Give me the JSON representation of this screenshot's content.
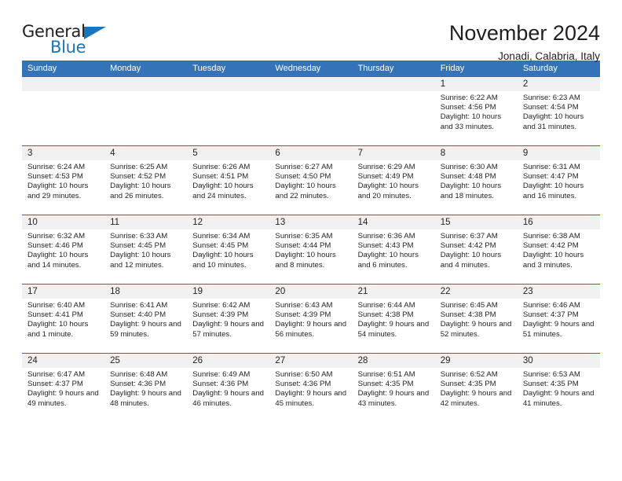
{
  "brand": {
    "name_part1": "General",
    "name_part2": "Blue",
    "accent_color": "#1b75bb"
  },
  "header": {
    "title": "November 2024",
    "subtitle": "Jonadi, Calabria, Italy"
  },
  "calendar": {
    "header_bg": "#3573b9",
    "weekdays": [
      "Sunday",
      "Monday",
      "Tuesday",
      "Wednesday",
      "Thursday",
      "Friday",
      "Saturday"
    ],
    "weeks": [
      [
        {
          "day": "",
          "sunrise": "",
          "sunset": "",
          "daylight": ""
        },
        {
          "day": "",
          "sunrise": "",
          "sunset": "",
          "daylight": ""
        },
        {
          "day": "",
          "sunrise": "",
          "sunset": "",
          "daylight": ""
        },
        {
          "day": "",
          "sunrise": "",
          "sunset": "",
          "daylight": ""
        },
        {
          "day": "",
          "sunrise": "",
          "sunset": "",
          "daylight": ""
        },
        {
          "day": "1",
          "sunrise": "Sunrise: 6:22 AM",
          "sunset": "Sunset: 4:56 PM",
          "daylight": "Daylight: 10 hours and 33 minutes."
        },
        {
          "day": "2",
          "sunrise": "Sunrise: 6:23 AM",
          "sunset": "Sunset: 4:54 PM",
          "daylight": "Daylight: 10 hours and 31 minutes."
        }
      ],
      [
        {
          "day": "3",
          "sunrise": "Sunrise: 6:24 AM",
          "sunset": "Sunset: 4:53 PM",
          "daylight": "Daylight: 10 hours and 29 minutes."
        },
        {
          "day": "4",
          "sunrise": "Sunrise: 6:25 AM",
          "sunset": "Sunset: 4:52 PM",
          "daylight": "Daylight: 10 hours and 26 minutes."
        },
        {
          "day": "5",
          "sunrise": "Sunrise: 6:26 AM",
          "sunset": "Sunset: 4:51 PM",
          "daylight": "Daylight: 10 hours and 24 minutes."
        },
        {
          "day": "6",
          "sunrise": "Sunrise: 6:27 AM",
          "sunset": "Sunset: 4:50 PM",
          "daylight": "Daylight: 10 hours and 22 minutes."
        },
        {
          "day": "7",
          "sunrise": "Sunrise: 6:29 AM",
          "sunset": "Sunset: 4:49 PM",
          "daylight": "Daylight: 10 hours and 20 minutes."
        },
        {
          "day": "8",
          "sunrise": "Sunrise: 6:30 AM",
          "sunset": "Sunset: 4:48 PM",
          "daylight": "Daylight: 10 hours and 18 minutes."
        },
        {
          "day": "9",
          "sunrise": "Sunrise: 6:31 AM",
          "sunset": "Sunset: 4:47 PM",
          "daylight": "Daylight: 10 hours and 16 minutes."
        }
      ],
      [
        {
          "day": "10",
          "sunrise": "Sunrise: 6:32 AM",
          "sunset": "Sunset: 4:46 PM",
          "daylight": "Daylight: 10 hours and 14 minutes."
        },
        {
          "day": "11",
          "sunrise": "Sunrise: 6:33 AM",
          "sunset": "Sunset: 4:45 PM",
          "daylight": "Daylight: 10 hours and 12 minutes."
        },
        {
          "day": "12",
          "sunrise": "Sunrise: 6:34 AM",
          "sunset": "Sunset: 4:45 PM",
          "daylight": "Daylight: 10 hours and 10 minutes."
        },
        {
          "day": "13",
          "sunrise": "Sunrise: 6:35 AM",
          "sunset": "Sunset: 4:44 PM",
          "daylight": "Daylight: 10 hours and 8 minutes."
        },
        {
          "day": "14",
          "sunrise": "Sunrise: 6:36 AM",
          "sunset": "Sunset: 4:43 PM",
          "daylight": "Daylight: 10 hours and 6 minutes."
        },
        {
          "day": "15",
          "sunrise": "Sunrise: 6:37 AM",
          "sunset": "Sunset: 4:42 PM",
          "daylight": "Daylight: 10 hours and 4 minutes."
        },
        {
          "day": "16",
          "sunrise": "Sunrise: 6:38 AM",
          "sunset": "Sunset: 4:42 PM",
          "daylight": "Daylight: 10 hours and 3 minutes."
        }
      ],
      [
        {
          "day": "17",
          "sunrise": "Sunrise: 6:40 AM",
          "sunset": "Sunset: 4:41 PM",
          "daylight": "Daylight: 10 hours and 1 minute."
        },
        {
          "day": "18",
          "sunrise": "Sunrise: 6:41 AM",
          "sunset": "Sunset: 4:40 PM",
          "daylight": "Daylight: 9 hours and 59 minutes."
        },
        {
          "day": "19",
          "sunrise": "Sunrise: 6:42 AM",
          "sunset": "Sunset: 4:39 PM",
          "daylight": "Daylight: 9 hours and 57 minutes."
        },
        {
          "day": "20",
          "sunrise": "Sunrise: 6:43 AM",
          "sunset": "Sunset: 4:39 PM",
          "daylight": "Daylight: 9 hours and 56 minutes."
        },
        {
          "day": "21",
          "sunrise": "Sunrise: 6:44 AM",
          "sunset": "Sunset: 4:38 PM",
          "daylight": "Daylight: 9 hours and 54 minutes."
        },
        {
          "day": "22",
          "sunrise": "Sunrise: 6:45 AM",
          "sunset": "Sunset: 4:38 PM",
          "daylight": "Daylight: 9 hours and 52 minutes."
        },
        {
          "day": "23",
          "sunrise": "Sunrise: 6:46 AM",
          "sunset": "Sunset: 4:37 PM",
          "daylight": "Daylight: 9 hours and 51 minutes."
        }
      ],
      [
        {
          "day": "24",
          "sunrise": "Sunrise: 6:47 AM",
          "sunset": "Sunset: 4:37 PM",
          "daylight": "Daylight: 9 hours and 49 minutes."
        },
        {
          "day": "25",
          "sunrise": "Sunrise: 6:48 AM",
          "sunset": "Sunset: 4:36 PM",
          "daylight": "Daylight: 9 hours and 48 minutes."
        },
        {
          "day": "26",
          "sunrise": "Sunrise: 6:49 AM",
          "sunset": "Sunset: 4:36 PM",
          "daylight": "Daylight: 9 hours and 46 minutes."
        },
        {
          "day": "27",
          "sunrise": "Sunrise: 6:50 AM",
          "sunset": "Sunset: 4:36 PM",
          "daylight": "Daylight: 9 hours and 45 minutes."
        },
        {
          "day": "28",
          "sunrise": "Sunrise: 6:51 AM",
          "sunset": "Sunset: 4:35 PM",
          "daylight": "Daylight: 9 hours and 43 minutes."
        },
        {
          "day": "29",
          "sunrise": "Sunrise: 6:52 AM",
          "sunset": "Sunset: 4:35 PM",
          "daylight": "Daylight: 9 hours and 42 minutes."
        },
        {
          "day": "30",
          "sunrise": "Sunrise: 6:53 AM",
          "sunset": "Sunset: 4:35 PM",
          "daylight": "Daylight: 9 hours and 41 minutes."
        }
      ]
    ]
  }
}
